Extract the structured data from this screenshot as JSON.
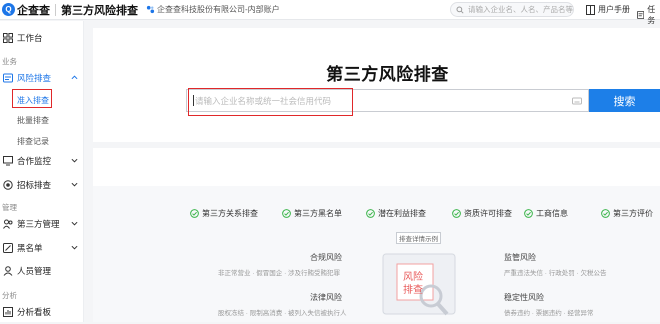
{
  "header": {
    "logo_text": "企查查",
    "app_title": "第三方风险排查",
    "company": "企查查科技股份有限公司-内部账户",
    "search_placeholder": "请输入企业名、人名、产品名等",
    "user_manual": "用户手册",
    "task_center": "任务"
  },
  "sidebar": {
    "workbench": "工作台",
    "group_business": "业务",
    "risk_check": "风险排查",
    "sub_access": "准入排查",
    "sub_batch": "批量排查",
    "sub_records": "排查记录",
    "cooperation_monitor": "合作监控",
    "bid_check": "招标排查",
    "group_manage": "管理",
    "third_party_manage": "第三方管理",
    "blacklist": "黑名单",
    "personnel_manage": "人员管理",
    "group_analysis": "分析",
    "analysis_board": "分析看板"
  },
  "main": {
    "title": "第三方风险排查",
    "input_placeholder": "请输入企业名称或统一社会信用代码",
    "search_button": "搜索"
  },
  "features": [
    "第三方关系排查",
    "第三方黑名单",
    "潜在利益排查",
    "资质许可排查",
    "工商信息",
    "第三方评价"
  ],
  "illustration": {
    "caption": "排查详情示例",
    "center_text_1": "风险",
    "center_text_2": "排查"
  },
  "blocks": {
    "compliance_title": "合规风险",
    "compliance_desc": "非正常营业 · 假冒国企 · 涉及行贿受贿犯罪",
    "legal_title": "法律风险",
    "legal_desc": "股权冻结 · 限制高消费 · 被列入失信被执行人",
    "regulatory_title": "监管风险",
    "regulatory_desc": "严重违法失信 · 行政处罚 · 欠税公告",
    "stability_title": "稳定性风险",
    "stability_desc": "债券违约 · 票据违约 · 经营异常"
  },
  "colors": {
    "accent": "#1d7fe8",
    "highlight": "#e0282a",
    "feature_check": "#3bb54a"
  }
}
